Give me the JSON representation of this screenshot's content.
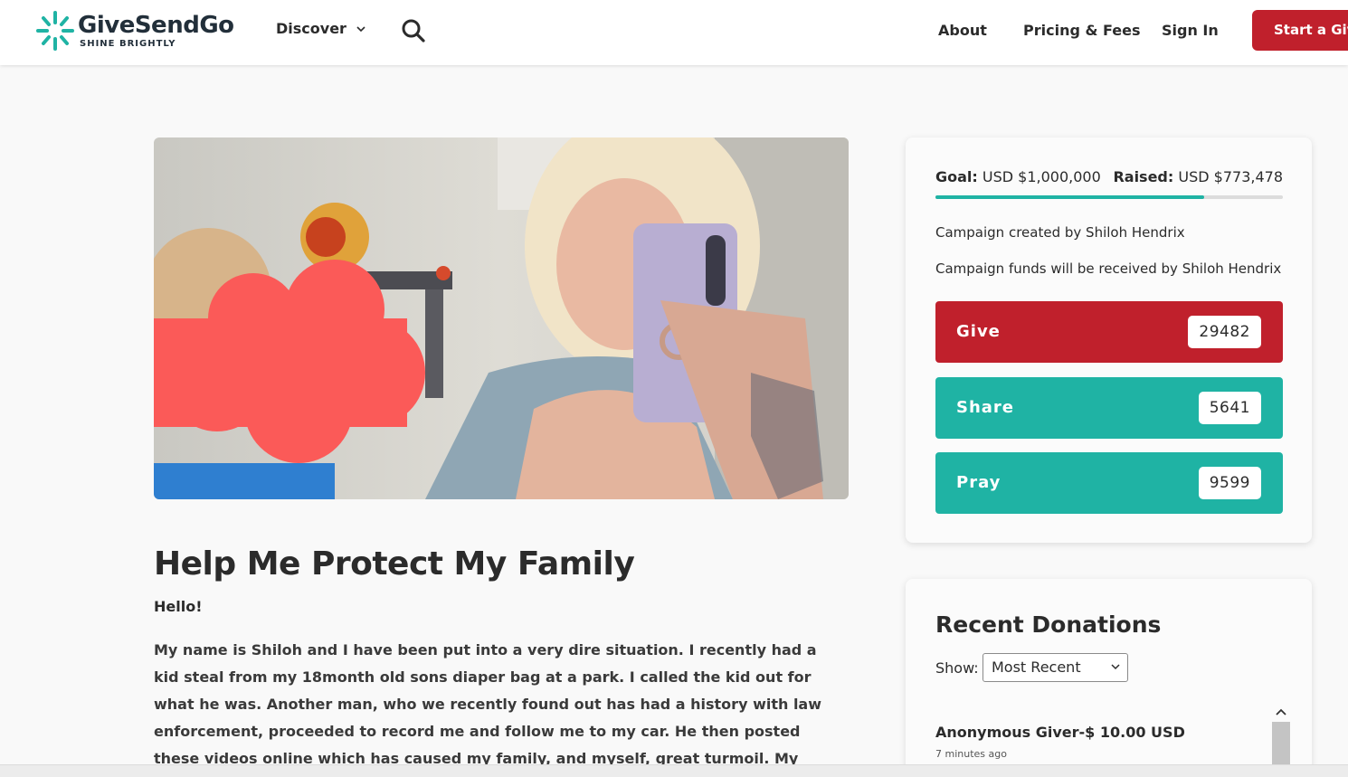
{
  "header": {
    "logo_name": "GiveSendGo",
    "logo_tagline": "SHINE BRIGHTLY",
    "discover_label": "Discover",
    "about_label": "About",
    "pricing_label": "Pricing & Fees",
    "signin_label": "Sign In",
    "start_label": "Start a Give"
  },
  "campaign": {
    "title": "Help Me Protect My Family",
    "greeting": "Hello!",
    "story": "My name is Shiloh and I have been put into a very dire situation. I recently had a kid steal from my 18month old sons diaper bag at a park. I called the kid out for what he was. Another man, who we recently found out has had a history with law enforcement, proceeded to record me and follow me to my car. He then posted these videos online which has caused my family, and myself, great turmoil. My SSN has been leaked. My"
  },
  "sidebar": {
    "goal_label": "Goal:",
    "goal_value": "USD $1,000,000",
    "raised_label": "Raised:",
    "raised_value": "USD $773,478",
    "progress_fraction": 0.773,
    "created_prefix": "Campaign created by",
    "created_name": "Shiloh Hendrix",
    "received_prefix": "Campaign funds will be received by",
    "received_name": "Shiloh Hendrix",
    "give_label": "Give",
    "give_count": "29482",
    "share_label": "Share",
    "share_count": "5641",
    "pray_label": "Pray",
    "pray_count": "9599"
  },
  "donations": {
    "title": "Recent Donations",
    "show_label": "Show:",
    "show_selected": "Most Recent",
    "items": [
      {
        "name": "Anonymous Giver-$ 10.00 USD",
        "time": "7 minutes ago"
      }
    ]
  },
  "colors": {
    "brand_red": "#c0202c",
    "brand_teal": "#1fb3a4",
    "text_dark": "#2b2b2b"
  },
  "icons": [
    "logo-burst-icon",
    "chevron-down-icon",
    "search-icon",
    "scroll-up-icon"
  ]
}
